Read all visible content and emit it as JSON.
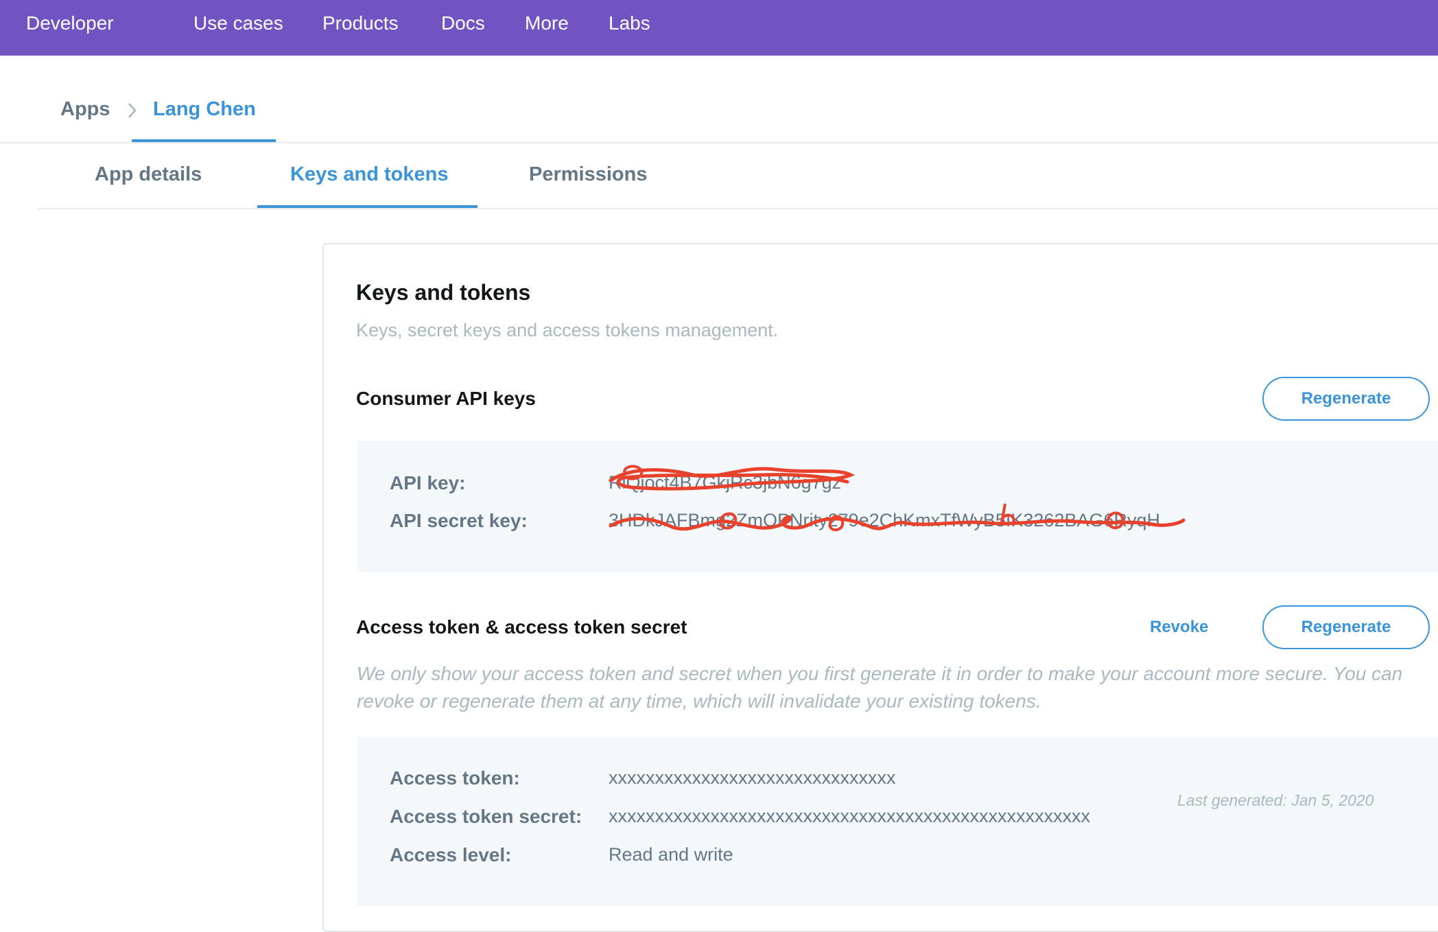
{
  "topnav": {
    "brand": "Developer",
    "items": [
      "Use cases",
      "Products",
      "Docs",
      "More",
      "Labs"
    ]
  },
  "breadcrumb": {
    "root": "Apps",
    "current": "Lang Chen"
  },
  "tabs": [
    {
      "label": "App details",
      "active": false
    },
    {
      "label": "Keys and tokens",
      "active": true
    },
    {
      "label": "Permissions",
      "active": false
    }
  ],
  "card": {
    "title": "Keys and tokens",
    "subtitle": "Keys, secret keys and access tokens management.",
    "consumer": {
      "heading": "Consumer API keys",
      "regenerate_label": "Regenerate",
      "api_key_label": "API key:",
      "api_key_value": "RlQjoct4B7GkjRc3jbN6g7gz",
      "api_secret_label": "API secret key:",
      "api_secret_value": "3HDkJAFBmg2ZmOPNrity279e2ChKmxTfWyB5IK3262BAG6RyqH"
    },
    "access": {
      "heading": "Access token & access token secret",
      "revoke_label": "Revoke",
      "regenerate_label": "Regenerate",
      "note": "We only show your access token and secret when you first generate it in order to make your account more secure. You can revoke or regenerate them at any time, which will invalidate your existing tokens.",
      "token_label": "Access token:",
      "token_value": "xxxxxxxxxxxxxxxxxxxxxxxxxxxxxxx",
      "secret_label": "Access token secret:",
      "secret_value": "xxxxxxxxxxxxxxxxxxxxxxxxxxxxxxxxxxxxxxxxxxxxxxxxxxxx",
      "level_label": "Access level:",
      "level_value": "Read and write",
      "last_generated": "Last generated: Jan 5, 2020"
    }
  },
  "colors": {
    "nav_bg": "#7153c2",
    "accent": "#3b94d9",
    "redaction": "#e8412c"
  },
  "icons": {
    "breadcrumb_separator": "chevron-right-icon"
  }
}
